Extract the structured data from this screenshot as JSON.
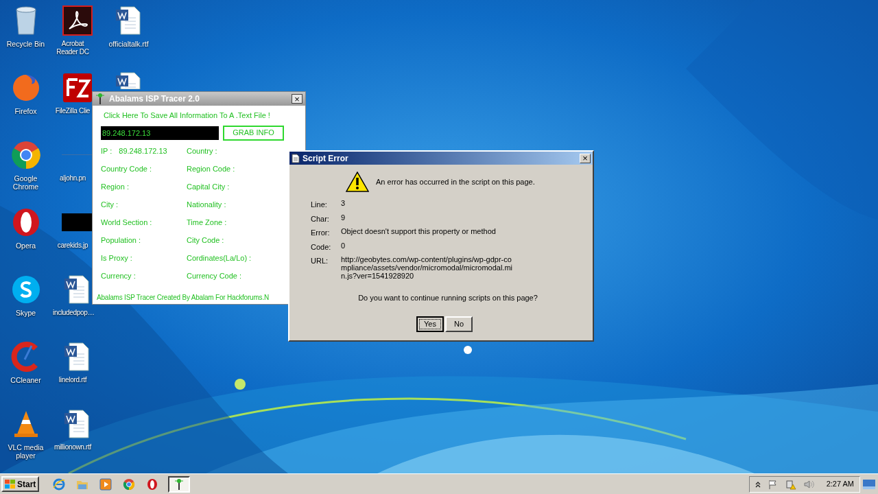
{
  "desktop": {
    "columns": [
      [
        {
          "kind": "recycle-bin",
          "label": "Recycle Bin"
        },
        {
          "kind": "firefox",
          "label": "Firefox"
        },
        {
          "kind": "chrome",
          "label": "Google Chrome"
        },
        {
          "kind": "opera",
          "label": "Opera"
        },
        {
          "kind": "skype",
          "label": "Skype"
        },
        {
          "kind": "ccleaner",
          "label": "CCleaner"
        },
        {
          "kind": "vlc",
          "label": "VLC media player"
        }
      ],
      [
        {
          "kind": "acrobat",
          "label": "Acrobat Reader DC"
        },
        {
          "kind": "filezilla",
          "label": "FileZilla Clie"
        },
        {
          "kind": "blank",
          "label": "aljohn.pn"
        },
        {
          "kind": "thumbnail",
          "label": "carekids.jp"
        },
        {
          "kind": "document",
          "label": "includedpop…"
        },
        {
          "kind": "document",
          "label": "linelord.rtf"
        },
        {
          "kind": "document",
          "label": "millionown.rtf"
        }
      ],
      [
        {
          "kind": "document",
          "label": "officialtalk.rtf"
        },
        {
          "kind": "document"
        }
      ]
    ]
  },
  "isp_window": {
    "title": "Abalams ISP Tracer 2.0",
    "close": "×",
    "save_link": "Click Here To Save All Information To A .Text File !",
    "ip_value": "89.248.172.13",
    "grab_button": "GRAB INFO",
    "fields": [
      {
        "label": "IP :",
        "value": "89.248.172.13"
      },
      {
        "label": "Country :"
      },
      {
        "label": "Country Code :"
      },
      {
        "label": "Region Code :"
      },
      {
        "label": "Region :"
      },
      {
        "label": "Capital City :"
      },
      {
        "label": "City :"
      },
      {
        "label": "Nationality :"
      },
      {
        "label": "World Section :"
      },
      {
        "label": "Time Zone :"
      },
      {
        "label": "Population :"
      },
      {
        "label": "City Code :"
      },
      {
        "label": "Is Proxy :"
      },
      {
        "label": "Cordinates(La/Lo) :"
      },
      {
        "label": "Currency :"
      },
      {
        "label": "Currency Code :"
      }
    ],
    "footer": "Abalams ISP Tracer Created By Abalam For Hackforums.N"
  },
  "script_error": {
    "title": "Script Error",
    "close": "×",
    "message": "An error has occurred in the script on this page.",
    "details": [
      {
        "label": "Line:",
        "value": "3"
      },
      {
        "label": "Char:",
        "value": "9"
      },
      {
        "label": "Error:",
        "value": "Object doesn't support this property or method"
      },
      {
        "label": "Code:",
        "value": "0"
      },
      {
        "label": "URL:",
        "value": "http://geobytes.com/wp-content/plugins/wp-gdpr-compliance/assets/vendor/micromodal/micromodal.min.js?ver=1541928920"
      }
    ],
    "question": "Do you want to continue running scripts on this page?",
    "buttons": [
      {
        "label": "Yes",
        "selected": true
      },
      {
        "label": "No",
        "selected": false
      }
    ]
  },
  "taskbar": {
    "start": "Start",
    "quick_launch": [
      {
        "kind": "ie"
      },
      {
        "kind": "folder"
      },
      {
        "kind": "media"
      },
      {
        "kind": "chrome"
      },
      {
        "kind": "opera"
      }
    ],
    "tasks": [
      {
        "kind": "antenna",
        "selected": true
      }
    ],
    "tray": [
      {
        "kind": "chevron"
      },
      {
        "kind": "flag"
      },
      {
        "kind": "network"
      },
      {
        "kind": "volume"
      }
    ],
    "clock": "2:27 AM"
  }
}
